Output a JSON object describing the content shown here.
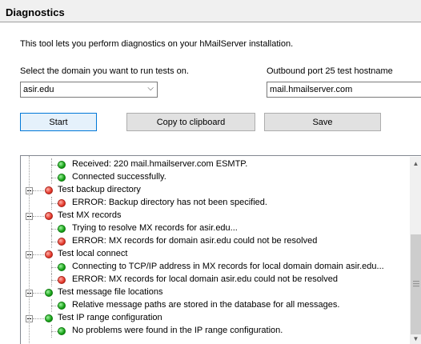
{
  "header": {
    "title": "Diagnostics"
  },
  "intro": "This tool lets you perform diagnostics on your hMailServer installation.",
  "domain": {
    "label": "Select the domain you want to run tests on.",
    "value": "asir.edu"
  },
  "outbound": {
    "label": "Outbound port 25 test hostname",
    "value": "mail.hmailserver.com"
  },
  "buttons": {
    "start": "Start",
    "copy": "Copy to clipboard",
    "save": "Save"
  },
  "results": [
    {
      "level": 1,
      "status": "green",
      "text": "Received: 220 mail.hmailserver.com ESMTP."
    },
    {
      "level": 1,
      "status": "green",
      "text": "Connected successfully."
    },
    {
      "level": 0,
      "status": "red",
      "text": "Test backup directory"
    },
    {
      "level": 1,
      "status": "red",
      "text": "ERROR: Backup directory has not been specified."
    },
    {
      "level": 0,
      "status": "red",
      "text": "Test MX records"
    },
    {
      "level": 1,
      "status": "green",
      "text": "Trying to resolve MX records for asir.edu..."
    },
    {
      "level": 1,
      "status": "red",
      "text": "ERROR: MX records for domain asir.edu could not be resolved"
    },
    {
      "level": 0,
      "status": "red",
      "text": "Test local connect"
    },
    {
      "level": 1,
      "status": "green",
      "text": "Connecting to TCP/IP address in MX records for local domain domain asir.edu..."
    },
    {
      "level": 1,
      "status": "red",
      "text": "ERROR: MX records for local domain asir.edu could not be resolved"
    },
    {
      "level": 0,
      "status": "green",
      "text": "Test message file locations"
    },
    {
      "level": 1,
      "status": "green",
      "text": "Relative message paths are stored in the database for all messages."
    },
    {
      "level": 0,
      "status": "green",
      "text": "Test IP range configuration"
    },
    {
      "level": 1,
      "status": "green",
      "text": "No problems were found in the IP range configuration."
    }
  ]
}
